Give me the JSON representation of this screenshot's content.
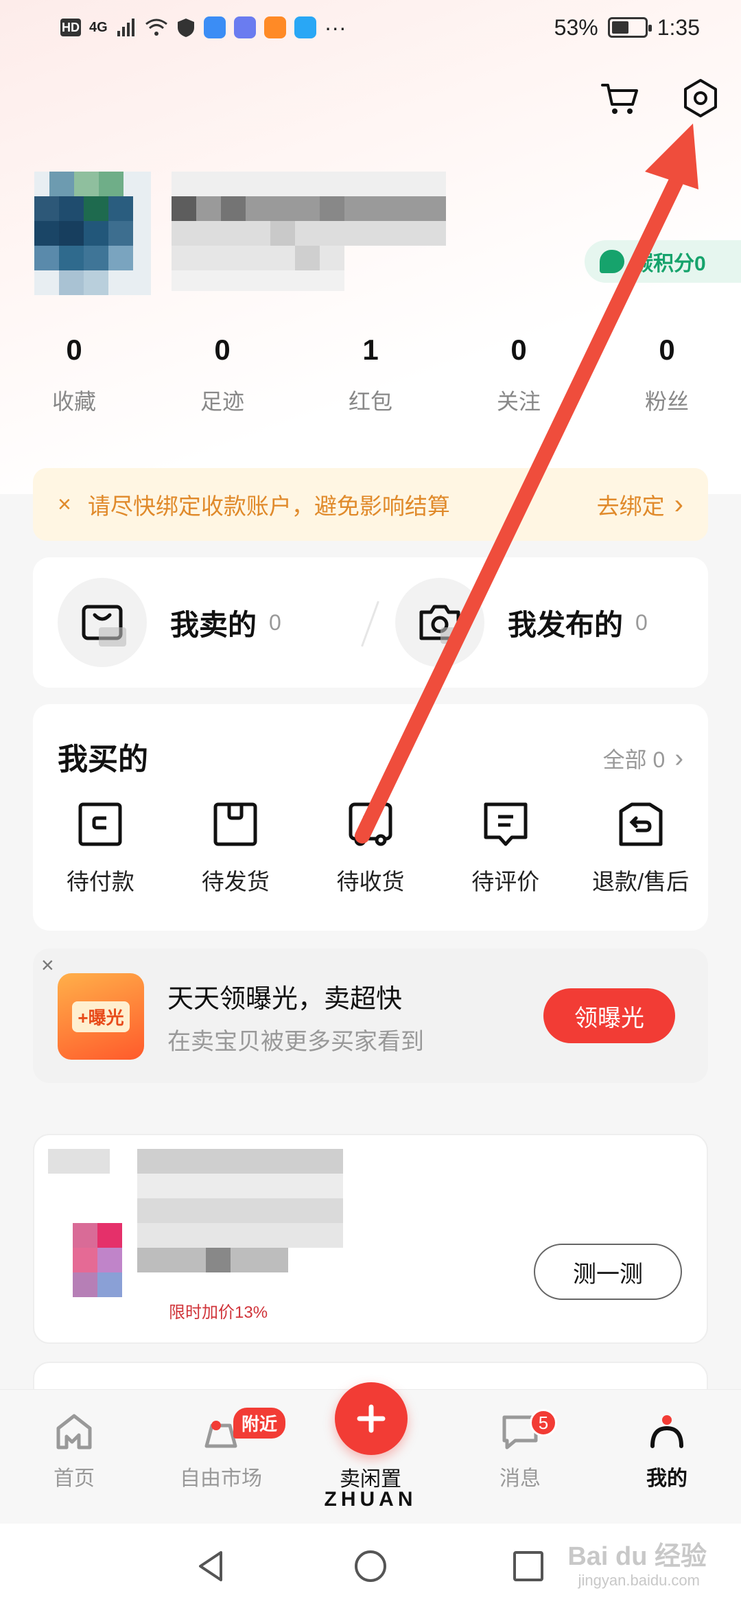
{
  "status_bar": {
    "hd": "HD",
    "signal": "4G",
    "dots": "···",
    "battery_pct": "53%",
    "battery_level": 0.53,
    "time": "1:35"
  },
  "header": {
    "cart_icon": "cart-icon",
    "settings_icon": "settings-icon"
  },
  "profile": {
    "carbon_badge": "碳积分0"
  },
  "stats": [
    {
      "num": "0",
      "label": "收藏"
    },
    {
      "num": "0",
      "label": "足迹"
    },
    {
      "num": "1",
      "label": "红包"
    },
    {
      "num": "0",
      "label": "关注"
    },
    {
      "num": "0",
      "label": "粉丝"
    }
  ],
  "notice": {
    "close": "×",
    "text": "请尽快绑定收款账户，避免影响结算",
    "action": "去绑定",
    "chevron": "›"
  },
  "sell": {
    "sold_label": "我卖的",
    "sold_count": "0",
    "published_label": "我发布的",
    "published_count": "0"
  },
  "bought": {
    "title": "我买的",
    "all_label": "全部 0",
    "chevron": "›",
    "items": [
      {
        "label": "待付款",
        "icon": "wallet-icon"
      },
      {
        "label": "待发货",
        "icon": "box-icon"
      },
      {
        "label": "待收货",
        "icon": "truck-icon"
      },
      {
        "label": "待评价",
        "icon": "comment-icon"
      },
      {
        "label": "退款/售后",
        "icon": "refund-icon"
      }
    ]
  },
  "promo": {
    "close": "×",
    "badge": "+曝光",
    "title": "天天领曝光，卖超快",
    "subtitle": "在卖宝贝被更多买家看到",
    "button": "领曝光"
  },
  "test_card": {
    "button": "测一测",
    "partial_text": "限时加价13%"
  },
  "bottom_nav": {
    "home": "首页",
    "market": "自由市场",
    "nearby_badge": "附近",
    "sell": "卖闲置",
    "brand": "ZHUAN",
    "messages": "消息",
    "messages_badge": "5",
    "mine": "我的"
  },
  "watermark": {
    "text": "Bai du 经验",
    "sub": "jingyan.baidu.com"
  },
  "colors": {
    "accent": "#f23c35",
    "notice_text": "#e08a2b",
    "carbon": "#16a36c"
  }
}
